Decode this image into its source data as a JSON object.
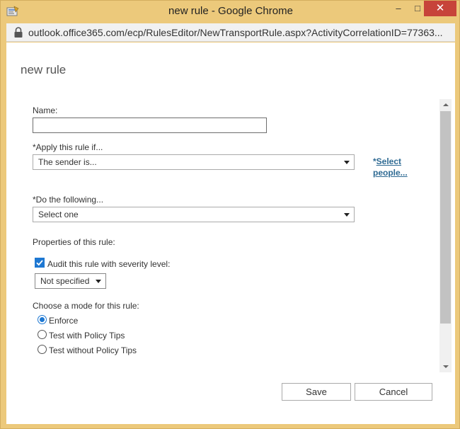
{
  "window": {
    "title": "new rule - Google Chrome",
    "controls": {
      "minimize": "–",
      "maximize": "□",
      "close": "✕"
    }
  },
  "addressbar": {
    "url": "outlook.office365.com/ecp/RulesEditor/NewTransportRule.aspx?ActivityCorrelationID=77363..."
  },
  "page": {
    "title": "new rule",
    "name_label": "Name:",
    "name_value": "",
    "apply_label": "*Apply this rule if...",
    "apply_value": "The sender is...",
    "select_people_prefix": "*",
    "select_people_line1": "Select",
    "select_people_line2": "people...",
    "do_label": "*Do the following...",
    "do_value": "Select one",
    "properties_label": "Properties of this rule:",
    "audit_label": "Audit this rule with severity level:",
    "audit_checked": true,
    "severity_value": "Not specified",
    "mode_label": "Choose a mode for this rule:",
    "modes": [
      "Enforce",
      "Test with Policy Tips",
      "Test without Policy Tips"
    ],
    "selected_mode": "Enforce"
  },
  "footer": {
    "save_label": "Save",
    "cancel_label": "Cancel"
  },
  "icons": {
    "app": "exchange-icon",
    "lock": "lock-icon",
    "checkbox": "checkmark-icon"
  },
  "colors": {
    "window_frame": "#ecc97b",
    "close_button": "#c7443a",
    "accent": "#1e78d2",
    "link": "#2e6a93"
  }
}
